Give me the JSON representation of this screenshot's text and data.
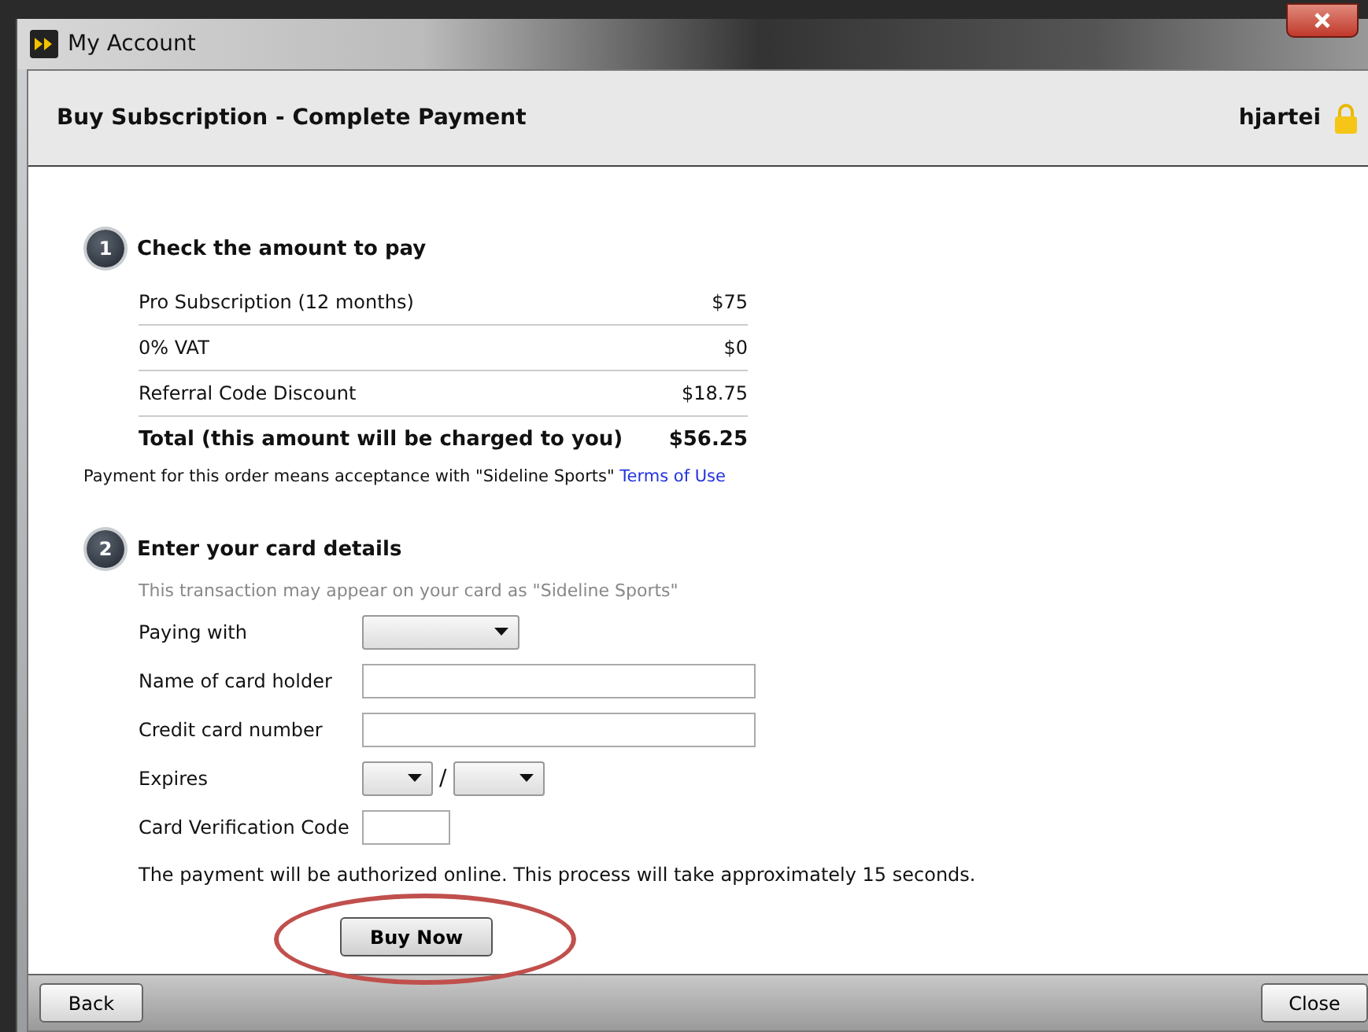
{
  "window": {
    "title": "My Account"
  },
  "header": {
    "title": "Buy Subscription - Complete Payment",
    "user": "hjartei"
  },
  "step1": {
    "number": "1",
    "title": "Check the amount to pay",
    "lines": [
      {
        "label": "Pro Subscription (12 months)",
        "amount": "$75",
        "kind": "item"
      },
      {
        "label": "0% VAT",
        "amount": "$0",
        "kind": "item"
      },
      {
        "label": "Referral Code Discount",
        "amount": "$18.75",
        "kind": "item"
      },
      {
        "label": "Total (this amount will be charged to you)",
        "amount": "$56.25",
        "kind": "total"
      }
    ],
    "terms_text": "Payment for this order means acceptance with \"Sideline Sports\"",
    "terms_link": "Terms of Use"
  },
  "step2": {
    "number": "2",
    "title": "Enter your card details",
    "note": "This transaction may appear on your card as \"Sideline Sports\"",
    "fields": [
      {
        "label": "Paying with",
        "kind": "select"
      },
      {
        "label": "Name of card holder",
        "kind": "text"
      },
      {
        "label": "Credit card number",
        "kind": "text"
      },
      {
        "label": "Expires",
        "kind": "expiry",
        "separator": "/"
      },
      {
        "label": "Card Verification Code",
        "kind": "short"
      }
    ],
    "info": "The payment will be authorized online. This process will take approximately 15 seconds.",
    "submit": "Buy Now"
  },
  "footer": {
    "back": "Back",
    "close": "Close"
  }
}
